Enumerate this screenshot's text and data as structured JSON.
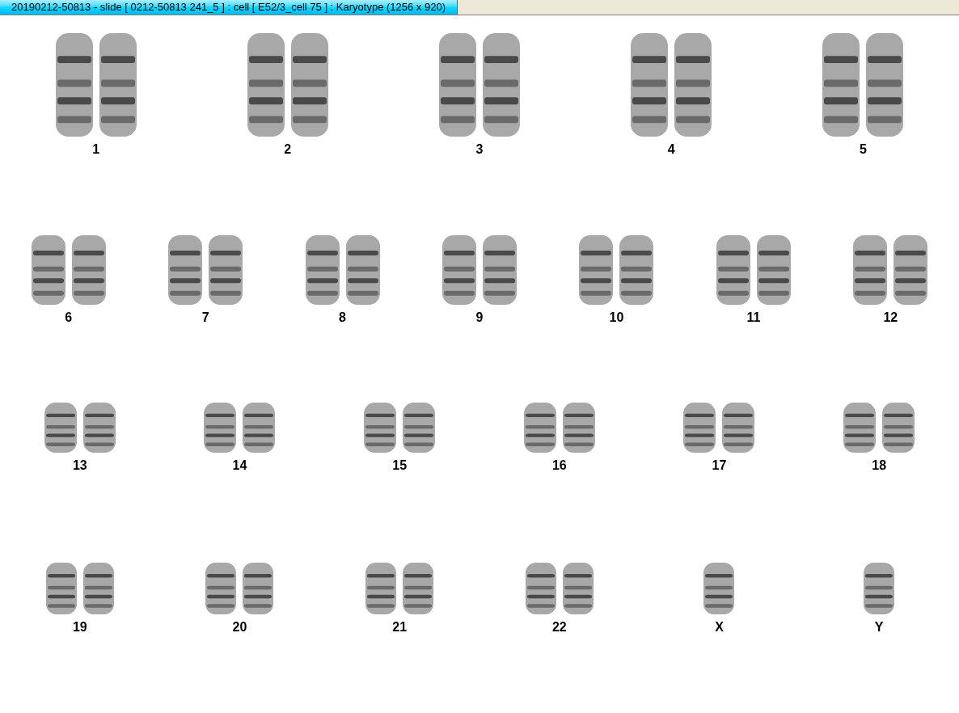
{
  "window": {
    "title": "20190212-50813 - slide [ 0212-50813 241_5 ] : cell [ E52/3_cell 75 ] : Karyotype  (1256 x 920)"
  },
  "rows": [
    {
      "items": [
        {
          "label": "1",
          "kind": "pair"
        },
        {
          "label": "2",
          "kind": "pair"
        },
        {
          "label": "3",
          "kind": "pair"
        },
        {
          "label": "4",
          "kind": "pair"
        },
        {
          "label": "5",
          "kind": "pair"
        }
      ]
    },
    {
      "items": [
        {
          "label": "6",
          "kind": "pair"
        },
        {
          "label": "7",
          "kind": "pair"
        },
        {
          "label": "8",
          "kind": "pair"
        },
        {
          "label": "9",
          "kind": "pair"
        },
        {
          "label": "10",
          "kind": "pair"
        },
        {
          "label": "11",
          "kind": "pair"
        },
        {
          "label": "12",
          "kind": "pair"
        }
      ]
    },
    {
      "items": [
        {
          "label": "13",
          "kind": "pair"
        },
        {
          "label": "14",
          "kind": "pair"
        },
        {
          "label": "15",
          "kind": "pair"
        },
        {
          "label": "16",
          "kind": "pair"
        },
        {
          "label": "17",
          "kind": "pair"
        },
        {
          "label": "18",
          "kind": "pair"
        }
      ]
    },
    {
      "items": [
        {
          "label": "19",
          "kind": "pair"
        },
        {
          "label": "20",
          "kind": "pair"
        },
        {
          "label": "21",
          "kind": "pair"
        },
        {
          "label": "22",
          "kind": "pair"
        },
        {
          "label": "X",
          "kind": "single"
        },
        {
          "label": "Y",
          "kind": "single"
        }
      ]
    }
  ]
}
